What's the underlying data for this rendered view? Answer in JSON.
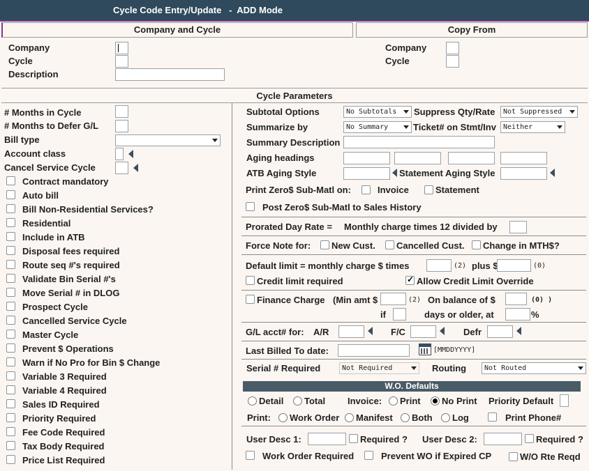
{
  "window": {
    "title": "Cycle Code Entry/Update   -  ADD Mode"
  },
  "sections": {
    "company_cycle": "Company and Cycle",
    "copy_from": "Copy From",
    "cycle_parameters": "Cycle Parameters"
  },
  "left_form": {
    "company": "Company",
    "cycle": "Cycle",
    "description": "Description"
  },
  "copy_form": {
    "company": "Company",
    "cycle": "Cycle"
  },
  "params": {
    "months_in_cycle": "# Months in Cycle",
    "months_defer": "# Months to Defer G/L",
    "bill_type": "Bill type",
    "account_class": "Account class",
    "cancel_service_cycle": "Cancel Service Cycle"
  },
  "checkboxes": [
    {
      "label": "Contract mandatory",
      "checked": false
    },
    {
      "label": "Auto bill",
      "checked": false
    },
    {
      "label": "Bill Non-Residential Services?",
      "checked": false
    },
    {
      "label": "Residential",
      "checked": false
    },
    {
      "label": "Include in ATB",
      "checked": false
    },
    {
      "label": "Disposal fees required",
      "checked": false
    },
    {
      "label": "Route seq #'s required",
      "checked": false
    },
    {
      "label": "Validate Bin Serial #'s",
      "checked": false
    },
    {
      "label": "Move Serial # in DLOG",
      "checked": false
    },
    {
      "label": "Prospect Cycle",
      "checked": false
    },
    {
      "label": "Cancelled Service Cycle",
      "checked": false
    },
    {
      "label": "Master Cycle",
      "checked": false
    },
    {
      "label": "Prevent $ Operations",
      "checked": false
    },
    {
      "label": "Warn if No Pro for Bin $ Change",
      "checked": false
    },
    {
      "label": "Variable 3 Required",
      "checked": false
    },
    {
      "label": "Variable 4 Required",
      "checked": false
    },
    {
      "label": "Sales ID Required",
      "checked": false
    },
    {
      "label": "Priority Required",
      "checked": false
    },
    {
      "label": "Fee Code Required",
      "checked": false
    },
    {
      "label": "Tax Body Required",
      "checked": false
    },
    {
      "label": "Price List Required",
      "checked": false
    }
  ],
  "right": {
    "subtotal_options": "Subtotal Options",
    "subtotal_value": "No Subtotals",
    "suppress_qty_rate": "Suppress Qty/Rate",
    "suppress_value": "Not Suppressed",
    "summarize_by": "Summarize by",
    "summarize_value": "No Summary",
    "ticket_on_stmt": "Ticket# on Stmt/Inv",
    "ticket_value": "Neither",
    "summary_description": "Summary Description",
    "aging_headings": "Aging headings",
    "atb_aging_style": "ATB Aging Style",
    "statement_aging_style": "Statement Aging Style",
    "print_zero_submatl": "Print Zero$ Sub-Matl on:",
    "invoice": "Invoice",
    "statement": "Statement",
    "post_zero": "Post Zero$ Sub-Matl to Sales History",
    "prorated_day_rate": "Prorated Day Rate =",
    "prorated_formula": "Monthly charge times 12 divided by",
    "force_note_for": "Force Note for:",
    "new_cust": "New Cust.",
    "cancelled_cust": "Cancelled Cust.",
    "change_mth": "Change in MTH$?",
    "default_limit": "Default limit = monthly charge $ times",
    "default_limit_dec": "(2)",
    "plus": "plus $",
    "plus_dec": "(0)",
    "credit_limit_required": "Credit limit required",
    "allow_credit_override": "Allow Credit Limit Override",
    "finance_charge": "Finance Charge",
    "min_amt": "(Min amt $",
    "min_dec": "(2)",
    "on_balance": "On balance of $",
    "bal_dec": "(0) )",
    "if_label": "if",
    "days_older": "days or older, at",
    "percent": "%",
    "gl_acct_for": "G/L acct# for:",
    "ar": "A/R",
    "fc": "F/C",
    "defr": "Defr",
    "last_billed": "Last Billed To date:",
    "date_format": "[MMDDYYYY]",
    "serial_required": "Serial # Required",
    "serial_value": "Not Required",
    "routing": "Routing",
    "routing_value": "Not Routed"
  },
  "wo": {
    "header": "W.O. Defaults",
    "detail": "Detail",
    "total": "Total",
    "invoice_label": "Invoice:",
    "print": "Print",
    "no_print": "No Print",
    "priority_default": "Priority Default",
    "print_label": "Print:",
    "work_order": "Work Order",
    "manifest": "Manifest",
    "both": "Both",
    "log": "Log",
    "print_phone": "Print Phone#",
    "user_desc_1": "User Desc 1:",
    "required1": "Required ?",
    "user_desc_2": "User Desc 2:",
    "required2": "Required ?",
    "work_order_required": "Work Order Required",
    "prevent_wo": "Prevent WO if Expired CP",
    "wo_rte_reqd": "W/O Rte Reqd",
    "selected_invoice": "No Print"
  },
  "colors": {
    "titlebar": "#2f4a5c",
    "background": "#fbf6f1",
    "wo_header": "#4a5b68",
    "accent_line": "#7a3c8a"
  }
}
